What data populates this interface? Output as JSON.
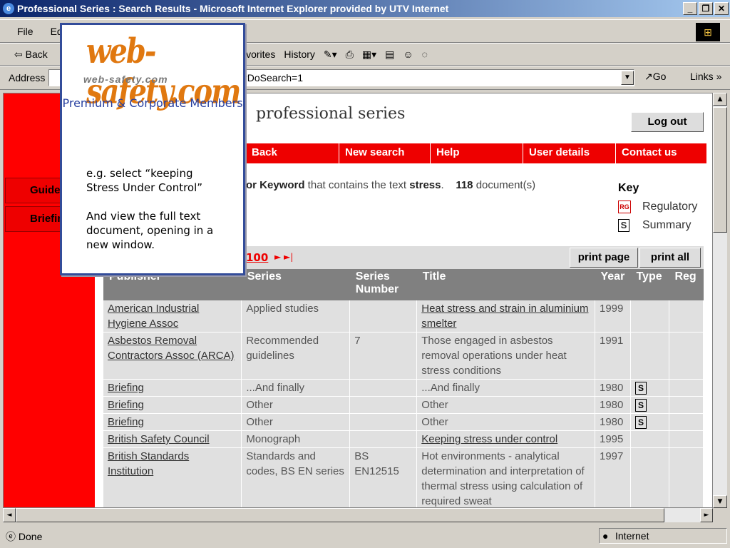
{
  "window": {
    "title": "Professional Series : Search Results - Microsoft Internet Explorer provided by UTV Internet",
    "buttons": [
      "_",
      "❐",
      "✕"
    ]
  },
  "menu": [
    "File",
    "Ed"
  ],
  "toolbar": {
    "back": "⇦ Back",
    "favorites": "Favorites",
    "history": "History"
  },
  "address": {
    "label": "Address",
    "value": "?DoSearch=1",
    "go": "Go",
    "links": "Links »"
  },
  "sidebar": {
    "items": [
      "Guide",
      "Briefin"
    ]
  },
  "page": {
    "brand": "professional series",
    "logout": "Log out",
    "nav": [
      "Back",
      "New search",
      "Help",
      "User details",
      "Contact us"
    ],
    "search_prefix": "or Keyword",
    "search_middle": " that contains the text ",
    "search_term": "stress",
    "search_count": "118",
    "search_suffix": " document(s)",
    "key_title": "Key",
    "key_regulatory": "Regulatory",
    "key_summary": "Summary",
    "pager_number": "100",
    "print_page": "print page",
    "print_all": "print all"
  },
  "table": {
    "headers": [
      "Publisher",
      "Series",
      "Series Number",
      "Title",
      "Year",
      "Type",
      "Reg"
    ],
    "rows": [
      {
        "publisher": "American Industrial Hygiene Assoc",
        "series": "Applied studies",
        "number": "",
        "title": "Heat stress and strain in aluminium smelter",
        "year": "1999",
        "type": "",
        "title_link": true
      },
      {
        "publisher": "Asbestos Removal Contractors Assoc (ARCA)",
        "series": "Recommended guidelines",
        "number": "7",
        "title": "Those engaged in asbestos removal operations under heat stress conditions",
        "year": "1991",
        "type": "",
        "title_link": false
      },
      {
        "publisher": "Briefing",
        "series": "...And finally",
        "number": "",
        "title": "...And finally",
        "year": "1980",
        "type": "S",
        "title_link": false
      },
      {
        "publisher": "Briefing",
        "series": "Other",
        "number": "",
        "title": "Other",
        "year": "1980",
        "type": "S",
        "title_link": false
      },
      {
        "publisher": "Briefing",
        "series": "Other",
        "number": "",
        "title": "Other",
        "year": "1980",
        "type": "S",
        "title_link": false
      },
      {
        "publisher": "British Safety Council",
        "series": "Monograph",
        "number": "",
        "title": "Keeping stress under control",
        "year": "1995",
        "type": "",
        "title_link": true
      },
      {
        "publisher": "British Standards Institution",
        "series": "Standards and codes, BS EN series",
        "number": "BS EN12515",
        "title": "Hot environments - analytical determination and interpretation of thermal stress using calculation of required sweat",
        "year": "1997",
        "type": "",
        "title_link": false
      }
    ]
  },
  "popup": {
    "logo": "web-safety.com",
    "logo_sub": "web-safety.com",
    "members": "Premium &  Corporate Members",
    "text1": "e.g. select “keeping Stress Under Control”",
    "text2": "And view the full text document, opening in a new window."
  },
  "status": {
    "done": "Done",
    "zone": "Internet"
  }
}
